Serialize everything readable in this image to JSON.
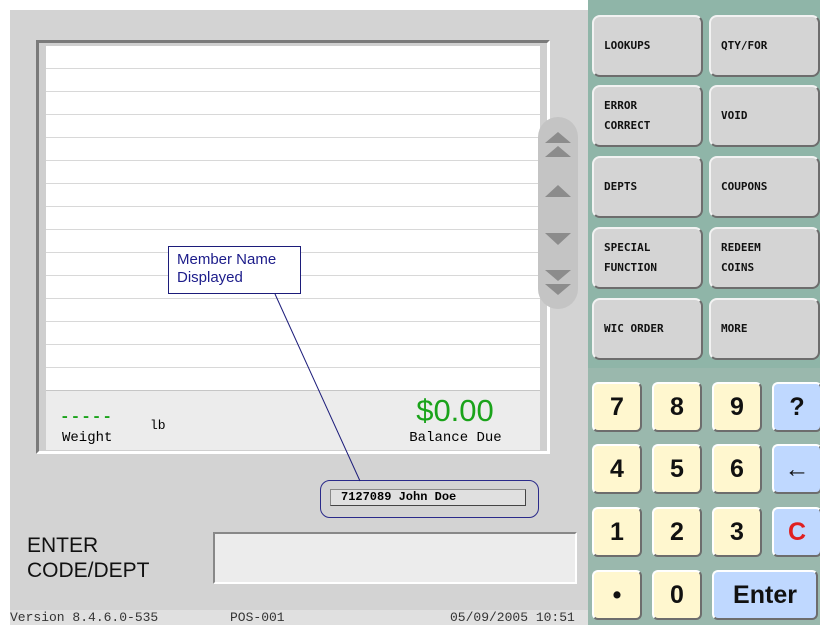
{
  "receipt": {
    "weight_dashes": "-----",
    "weight_unit": "lb",
    "weight_label": "Weight",
    "balance_value": "$0.00",
    "balance_label": "Balance Due"
  },
  "member": {
    "tag": "7127089 John Doe"
  },
  "annotation": {
    "callout_line1": "Member Name",
    "callout_line2": "Displayed"
  },
  "entry": {
    "prompt_line1": "ENTER",
    "prompt_line2": "CODE/DEPT",
    "value": ""
  },
  "status": {
    "version": "Version  8.4.6.0-535",
    "terminal": "POS-001",
    "datetime": "05/09/2005 10:51"
  },
  "function_keys": [
    {
      "label": "LOOKUPS"
    },
    {
      "label": "QTY/FOR"
    },
    {
      "label": "ERROR\nCORRECT"
    },
    {
      "label": "VOID"
    },
    {
      "label": "DEPTS"
    },
    {
      "label": "COUPONS"
    },
    {
      "label": "SPECIAL\nFUNCTION"
    },
    {
      "label": "REDEEM\nCOINS"
    },
    {
      "label": "WIC ORDER"
    },
    {
      "label": "MORE"
    }
  ],
  "keypad": {
    "k7": "7",
    "k8": "8",
    "k9": "9",
    "help": "?",
    "k4": "4",
    "k5": "5",
    "k6": "6",
    "back": "←",
    "k1": "1",
    "k2": "2",
    "k3": "3",
    "clear": "C",
    "dot": "•",
    "k0": "0",
    "enter": "Enter"
  },
  "colors": {
    "total_green": "#1aa31a",
    "panel_green": "#8fb5a8",
    "key_yellow": "#fff7cf",
    "key_blue": "#bfd8ff",
    "clear_red": "#e02020",
    "annotation_blue": "#1c1c8a"
  },
  "icons": {
    "scroll_top": "double-up-arrow-icon",
    "scroll_up": "up-arrow-icon",
    "scroll_down": "down-arrow-icon",
    "scroll_bottom": "double-down-arrow-icon"
  }
}
